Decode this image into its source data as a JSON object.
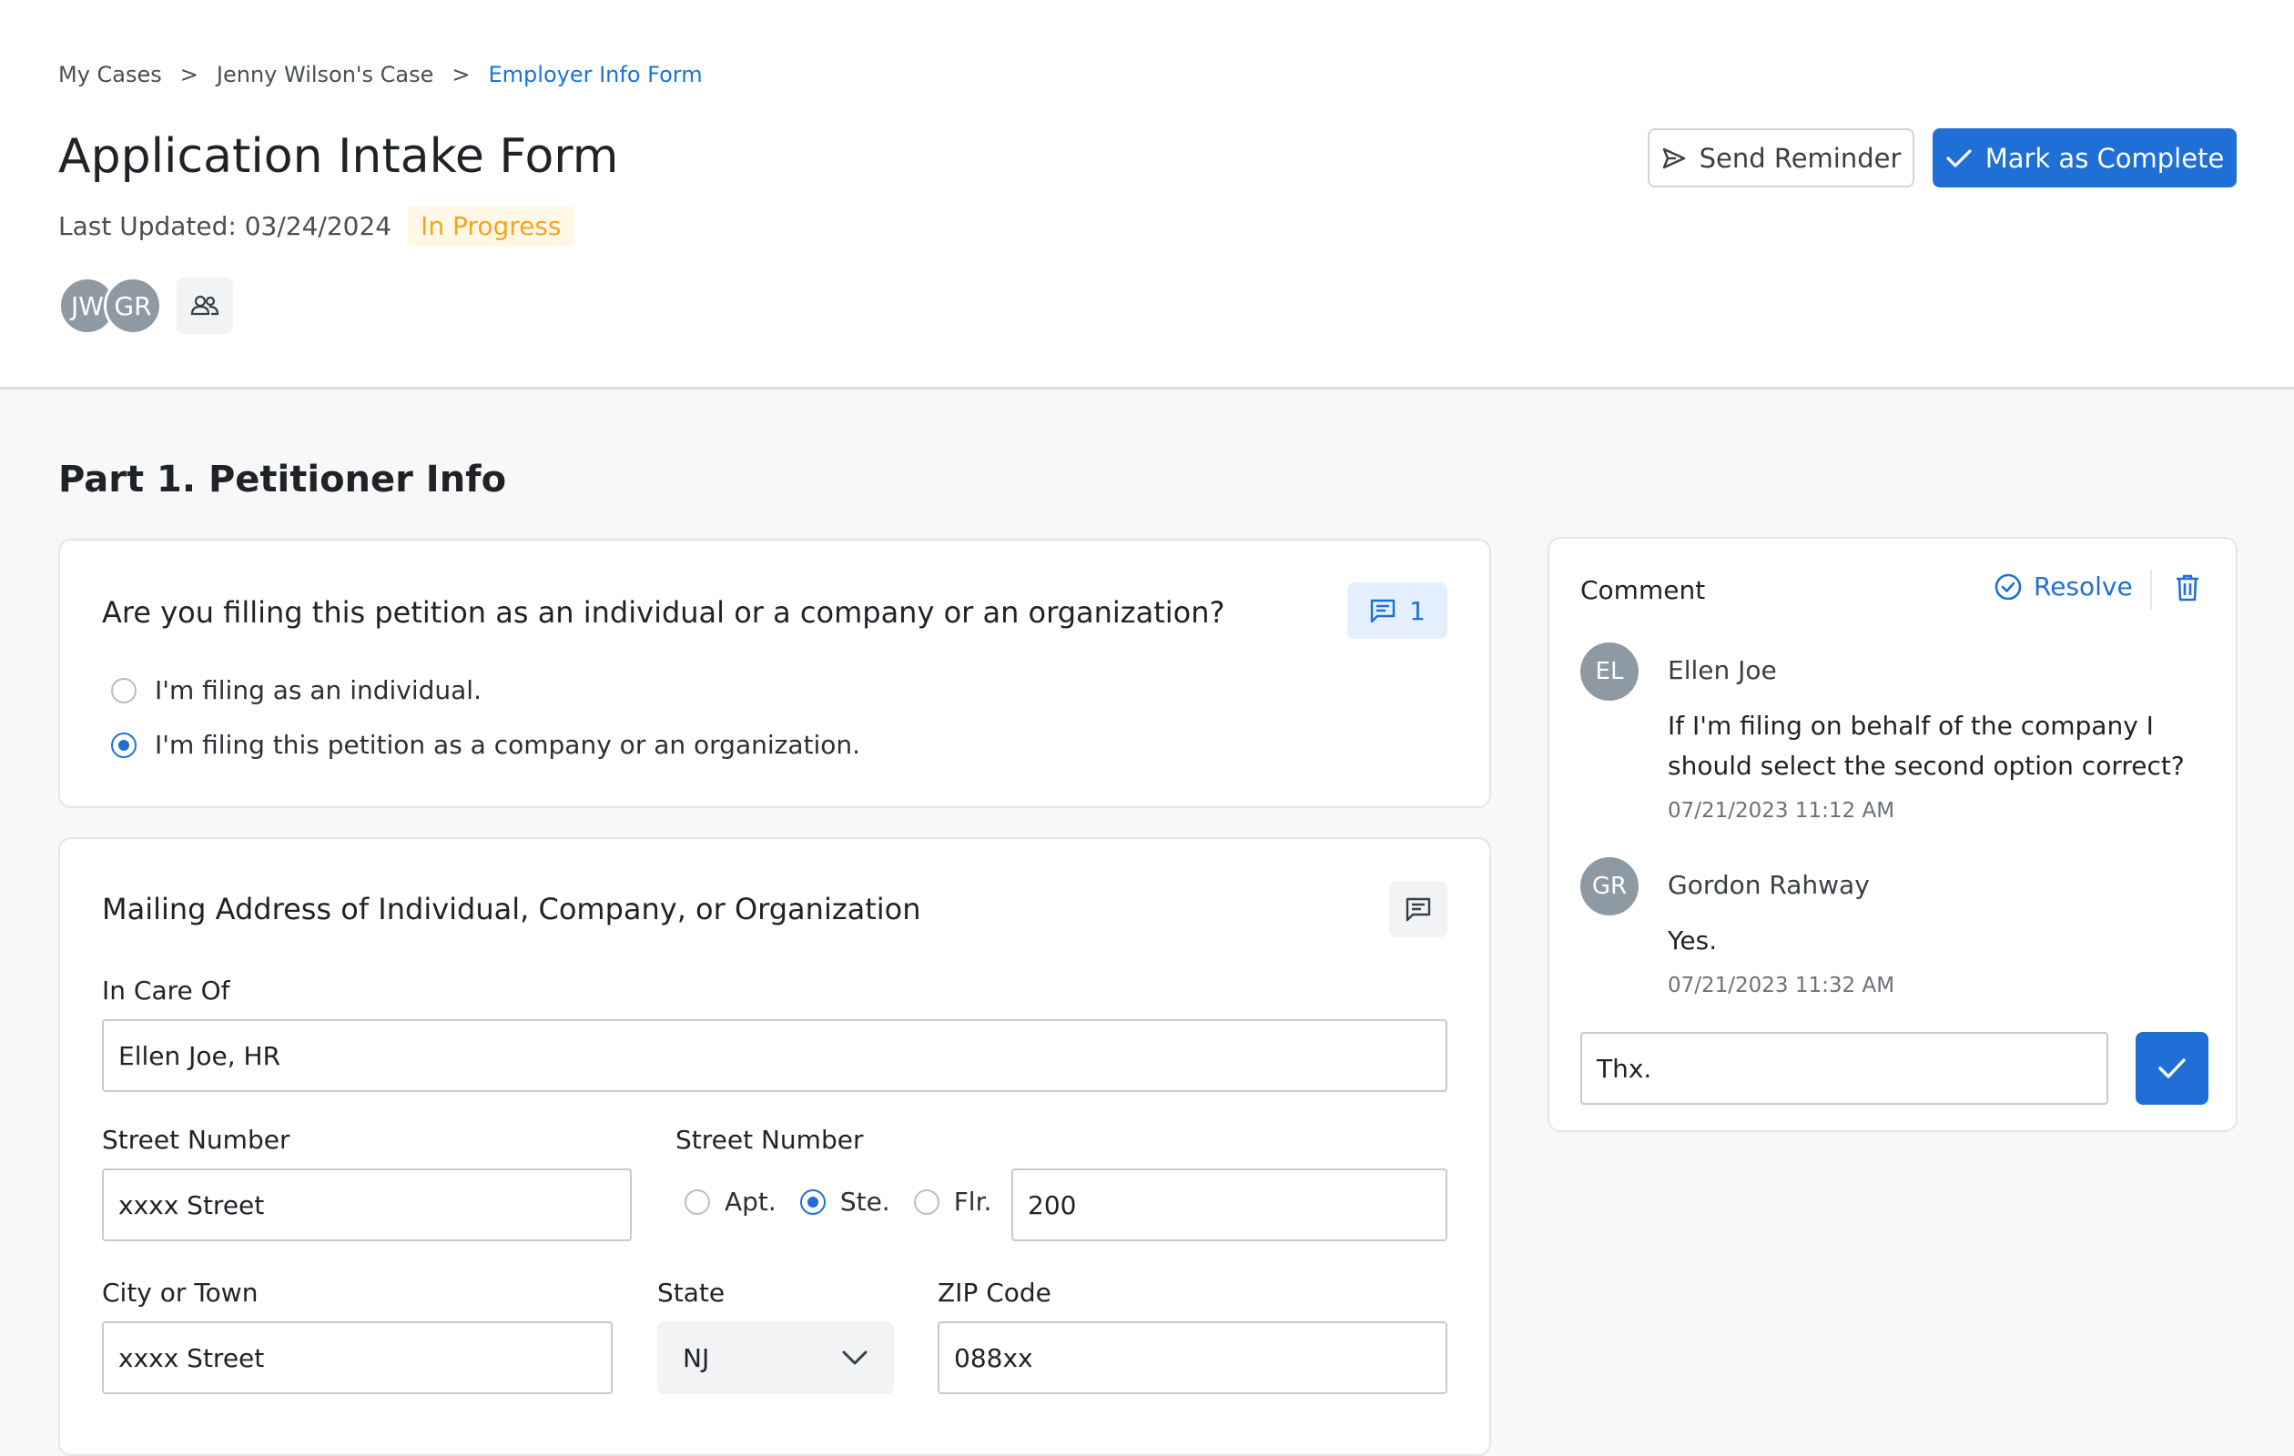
{
  "breadcrumb": {
    "items": [
      "My Cases",
      "Jenny Wilson's Case"
    ],
    "separator": ">",
    "current": "Employer Info Form"
  },
  "header": {
    "title": "Application Intake Form",
    "last_updated": "Last Updated: 03/24/2024",
    "status": "In Progress",
    "avatars": [
      "JW",
      "GR"
    ],
    "send_reminder_label": "Send Reminder",
    "mark_complete_label": "Mark as Complete"
  },
  "section": {
    "title": "Part 1. Petitioner Info"
  },
  "question1": {
    "title": "Are you filling this petition as an individual or a company or an organization?",
    "comment_count": "1",
    "options": [
      "I'm filing as an individual.",
      "I'm filing this petition as a company or an organization."
    ],
    "selected_index": 1
  },
  "address": {
    "title": "Mailing Address of Individual, Company, or Organization",
    "in_care_of_label": "In Care Of",
    "in_care_of_value": "Ellen Joe, HR",
    "street_label": "Street Number",
    "street_value": "xxxx Street",
    "unit_label": "Street Number",
    "unit_options": [
      "Apt.",
      "Ste.",
      "Flr."
    ],
    "unit_selected": "Ste.",
    "unit_value": "200",
    "city_label": "City or Town",
    "city_value": "xxxx Street",
    "state_label": "State",
    "state_value": "NJ",
    "zip_label": "ZIP Code",
    "zip_value": "088xx"
  },
  "comments": {
    "title": "Comment",
    "resolve_label": "Resolve",
    "thread": [
      {
        "initials": "EL",
        "name": "Ellen Joe",
        "text": "If I'm filing on behalf of the company I should select the second option correct?",
        "time": "07/21/2023 11:12 AM"
      },
      {
        "initials": "GR",
        "name": "Gordon Rahway",
        "text": "Yes.",
        "time": "07/21/2023 11:32 AM"
      }
    ],
    "reply_value": "Thx."
  },
  "colors": {
    "accent": "#1f6fd6",
    "status": "#f2a51f",
    "avatar": "#8e9aa3"
  }
}
